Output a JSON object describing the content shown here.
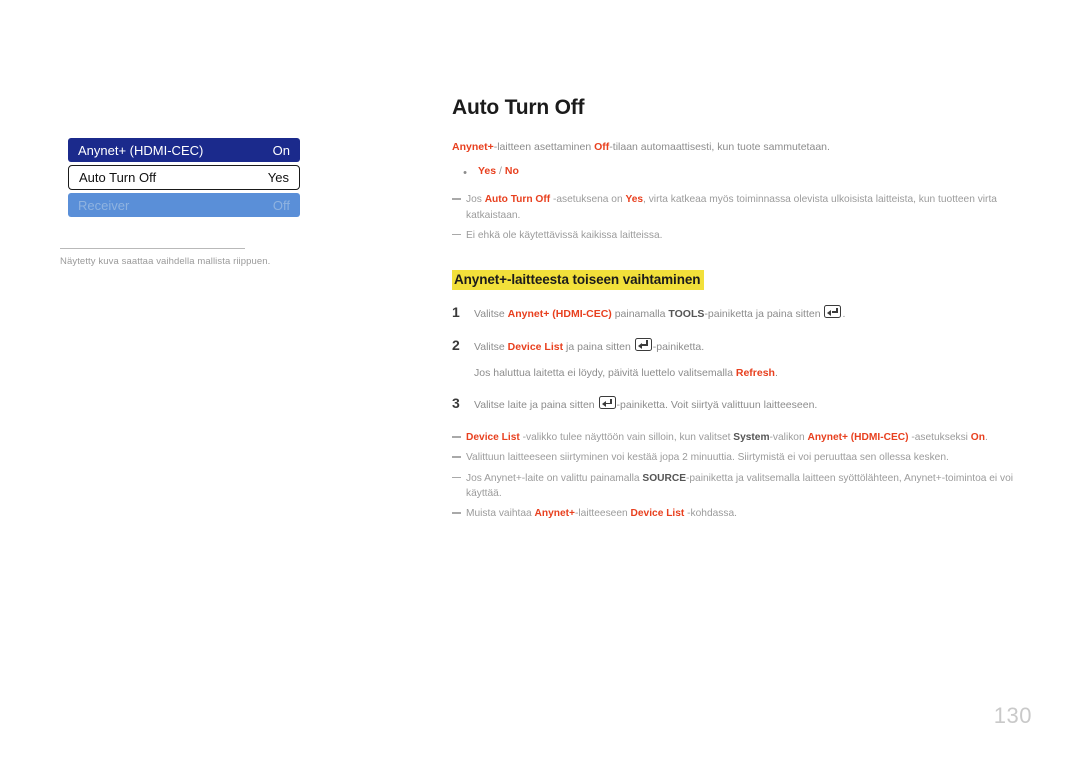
{
  "page": {
    "title": "Auto Turn Off",
    "number": "130"
  },
  "osd_menu": {
    "rows": [
      {
        "label": "Anynet+ (HDMI-CEC)",
        "value": "On",
        "state": "selected"
      },
      {
        "label": "Auto Turn Off",
        "value": "Yes",
        "state": "active"
      },
      {
        "label": "Receiver",
        "value": "Off",
        "state": "disabled"
      }
    ],
    "caption": "Näytetty kuva saattaa vaihdella mallista riippuen."
  },
  "intro": {
    "kw1": "Anynet+",
    "text1": "-laitteen asettaminen ",
    "kw2": "Off",
    "text2": "-tilaan automaattisesti, kun tuote sammutetaan."
  },
  "option_bullet": {
    "dot": "•",
    "yes": "Yes",
    "separator": "/",
    "no": "No"
  },
  "intro_notes": [
    {
      "t1": "Jos ",
      "kw1": "Auto Turn Off",
      "t2": " -asetuksena on ",
      "kw2": "Yes",
      "t3": ", virta katkeaa myös toiminnassa olevista ulkoisista laitteista, kun tuotteen virta katkaistaan."
    },
    {
      "t1": "Ei ehkä ole käytettävissä kaikissa laitteissa."
    }
  ],
  "section": {
    "heading": "Anynet+-laitteesta toiseen vaihtaminen"
  },
  "steps": [
    {
      "num": "1",
      "t1": "Valitse ",
      "kw1": "Anynet+ (HDMI-CEC)",
      "t2": " painamalla ",
      "kw2": "TOOLS",
      "t3": "-painiketta ja paina sitten ",
      "t4": "."
    },
    {
      "num": "2",
      "t1": "Valitse ",
      "kw1": "Device List",
      "t2": " ja paina sitten ",
      "t3": "-painiketta.",
      "sub_t1": "Jos haluttua laitetta ei löydy, päivitä luettelo valitsemalla ",
      "sub_kw": "Refresh",
      "sub_t2": "."
    },
    {
      "num": "3",
      "t1": "Valitse laite ja paina sitten ",
      "t2": "-painiketta. Voit siirtyä valittuun laitteeseen."
    }
  ],
  "end_notes": [
    {
      "kw1": "Device List",
      "t1": " -valikko tulee näyttöön vain silloin, kun valitset ",
      "kw2": "System",
      "t2": "-valikon ",
      "kw3": "Anynet+ (HDMI-CEC)",
      "t3": " -asetukseksi ",
      "kw4": "On",
      "t4": "."
    },
    {
      "t1": "Valittuun laitteeseen siirtyminen voi kestää jopa 2 minuuttia. Siirtymistä ei voi peruuttaa sen ollessa kesken."
    },
    {
      "t1": "Jos Anynet+-laite on valittu painamalla ",
      "kw1": "SOURCE",
      "t2": "-painiketta ja valitsemalla laitteen syöttölähteen, Anynet+-toimintoa ei voi käyttää."
    },
    {
      "t1": "Muista vaihtaa ",
      "kw1": "Anynet+",
      "t2": "-laitteeseen ",
      "kw2": "Device List",
      "t3": " -kohdassa."
    }
  ],
  "icons": {
    "enter_key": "enter-key-icon"
  },
  "colors": {
    "keyword_red": "#e8401f",
    "highlight_yellow": "#f2e03a",
    "osd_selected_blue": "#1b2a8c",
    "osd_disabled_blue": "#5a8fd8",
    "body_gray": "#8c8c8c"
  }
}
